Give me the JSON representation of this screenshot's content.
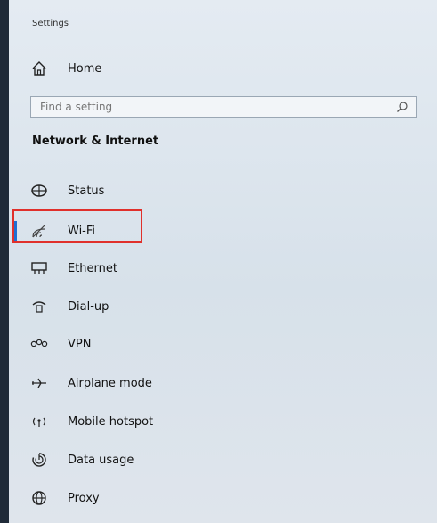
{
  "window": {
    "title": "Settings"
  },
  "home": {
    "label": "Home",
    "icon": "home-icon"
  },
  "search": {
    "placeholder": "Find a setting",
    "value": "",
    "icon": "search-icon"
  },
  "section": {
    "title": "Network & Internet"
  },
  "nav": {
    "selected": "Wi-Fi",
    "items": [
      {
        "label": "Status",
        "icon": "globe-status-icon"
      },
      {
        "label": "Wi-Fi",
        "icon": "wifi-icon"
      },
      {
        "label": "Ethernet",
        "icon": "ethernet-icon"
      },
      {
        "label": "Dial-up",
        "icon": "dial-up-icon"
      },
      {
        "label": "VPN",
        "icon": "vpn-icon"
      },
      {
        "label": "Airplane mode",
        "icon": "airplane-icon"
      },
      {
        "label": "Mobile hotspot",
        "icon": "hotspot-icon"
      },
      {
        "label": "Data usage",
        "icon": "data-usage-icon"
      },
      {
        "label": "Proxy",
        "icon": "proxy-icon"
      }
    ]
  },
  "colors": {
    "accent": "#1f6fd1",
    "highlight": "#e0302b"
  }
}
